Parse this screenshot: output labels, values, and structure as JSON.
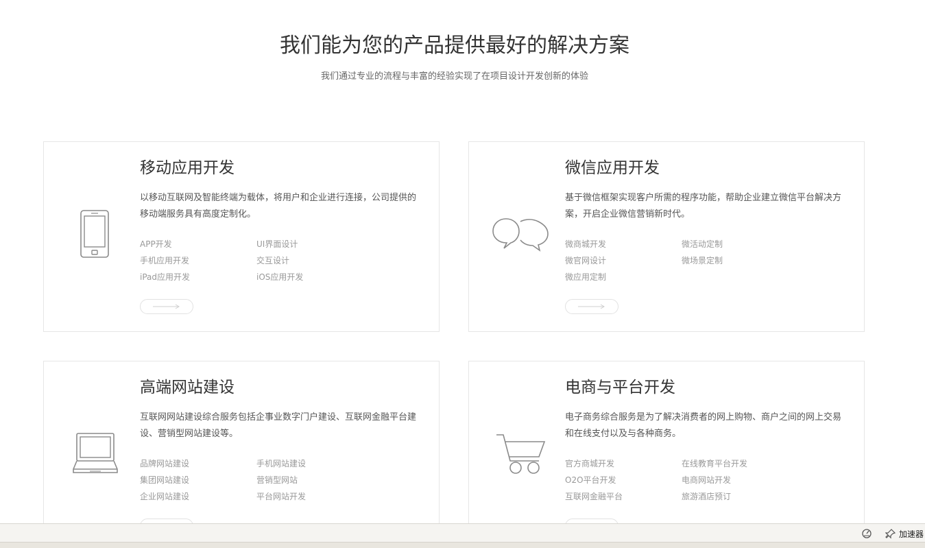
{
  "header": {
    "title": "我们能为您的产品提供最好的解决方案",
    "subtitle": "我们通过专业的流程与丰富的经验实现了在项目设计开发创新的体验"
  },
  "cards": [
    {
      "title": "移动应用开发",
      "description": "以移动互联网及智能终端为载体，将用户和企业进行连接，公司提供的移动端服务具有高度定制化。",
      "icon": "phone-icon",
      "links": [
        "APP开发",
        "UI界面设计",
        "手机应用开发",
        "交互设计",
        "iPad应用开发",
        "iOS应用开发"
      ]
    },
    {
      "title": "微信应用开发",
      "description": "基于微信框架实现客户所需的程序功能，帮助企业建立微信平台解决方案，开启企业微信营销新时代。",
      "icon": "chat-bubbles-icon",
      "links": [
        "微商城开发",
        "微活动定制",
        "微官网设计",
        "微场景定制",
        "微应用定制"
      ]
    },
    {
      "title": "高端网站建设",
      "description": "互联网网站建设综合服务包括企事业数字门户建设、互联网金融平台建设、营销型网站建设等。",
      "icon": "laptop-icon",
      "links": [
        "品牌网站建设",
        "手机网站建设",
        "集团网站建设",
        "营销型网站",
        "企业网站建设",
        "平台网站开发"
      ]
    },
    {
      "title": "电商与平台开发",
      "description": "电子商务综合服务是为了解决消费者的网上购物、商户之间的网上交易和在线支付以及与各种商务。",
      "icon": "shopping-cart-icon",
      "links": [
        "官方商城开发",
        "在线教育平台开发",
        "O2O平台开发",
        "电商网站开发",
        "互联网金融平台",
        "旅游酒店预订"
      ]
    }
  ],
  "statusbar": {
    "accelerator_label": "加速器",
    "icons": [
      "speed-dial-icon",
      "pin-icon"
    ]
  },
  "colors": {
    "border": "#e6e6e6",
    "icon_stroke": "#8a8a8a",
    "link_text": "#999999",
    "title_text": "#333333"
  }
}
